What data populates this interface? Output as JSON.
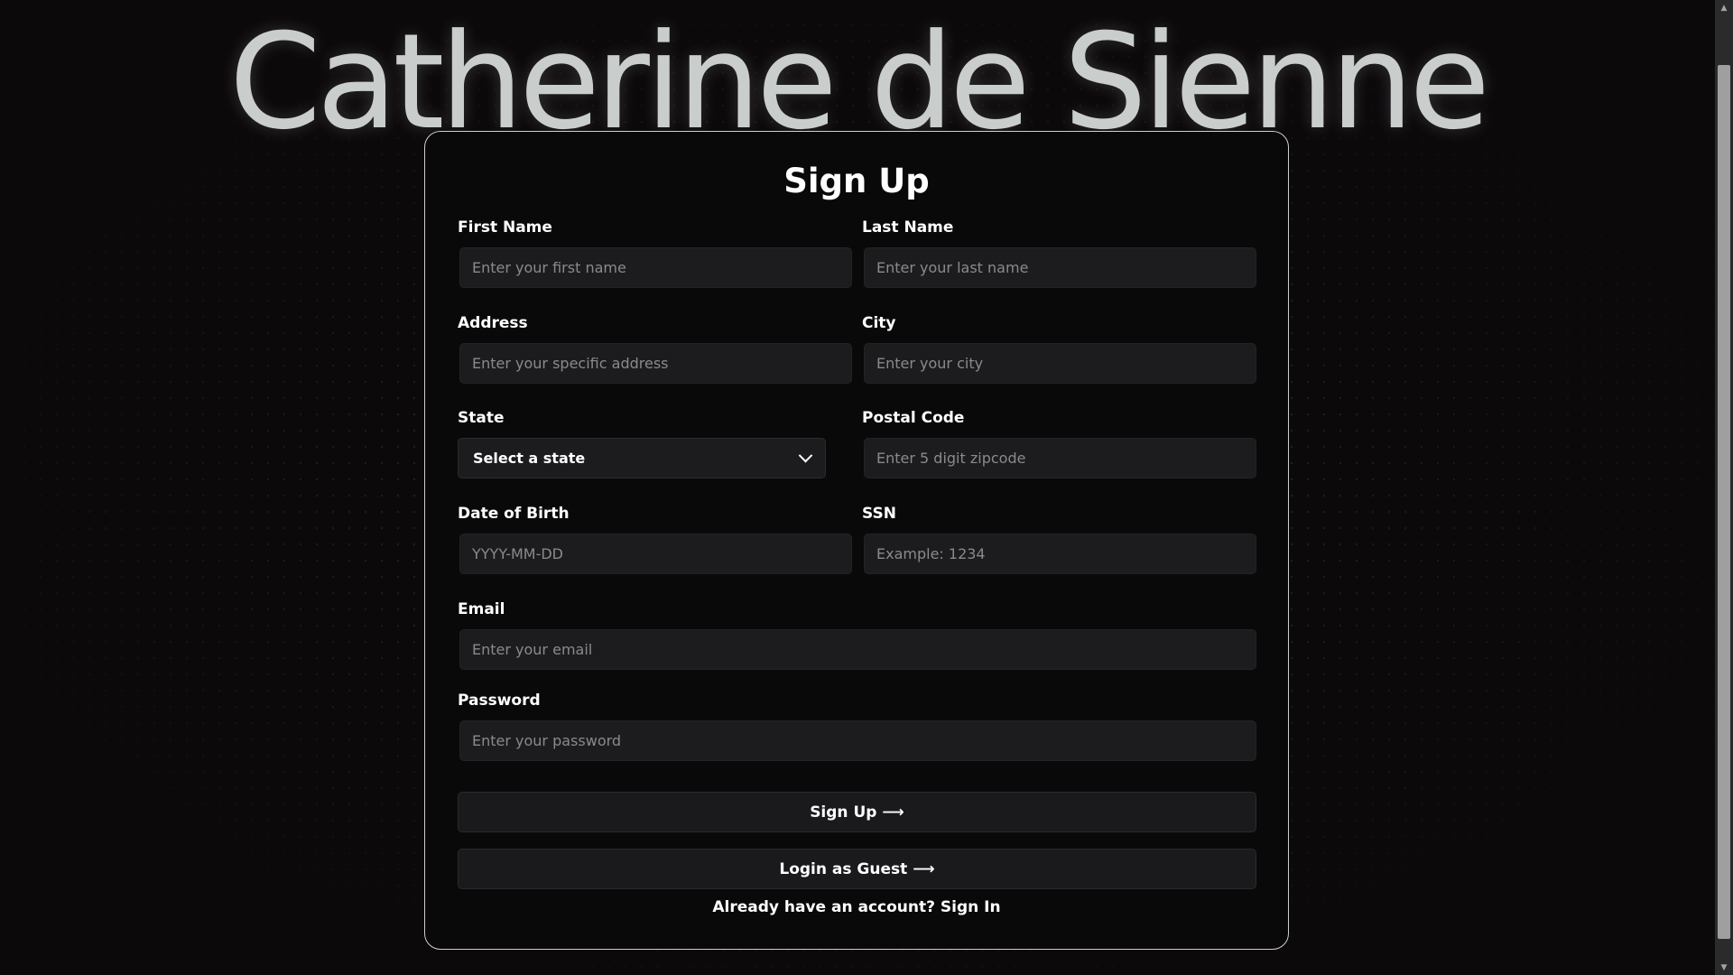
{
  "brand": {
    "name": "Catherine de Sienne"
  },
  "form": {
    "title": "Sign Up",
    "fields": {
      "first_name": {
        "label": "First Name",
        "placeholder": "Enter your first name"
      },
      "last_name": {
        "label": "Last Name",
        "placeholder": "Enter your last name"
      },
      "address": {
        "label": "Address",
        "placeholder": "Enter your specific address"
      },
      "city": {
        "label": "City",
        "placeholder": "Enter your city"
      },
      "state": {
        "label": "State",
        "selected": "Select a state"
      },
      "postal_code": {
        "label": "Postal Code",
        "placeholder": "Enter 5 digit zipcode"
      },
      "dob": {
        "label": "Date of Birth",
        "placeholder": "YYYY-MM-DD"
      },
      "ssn": {
        "label": "SSN",
        "placeholder": "Example: 1234"
      },
      "email": {
        "label": "Email",
        "placeholder": "Enter your email"
      },
      "password": {
        "label": "Password",
        "placeholder": "Enter your password"
      }
    },
    "buttons": {
      "sign_up": "Sign Up",
      "guest": "Login as Guest",
      "arrow": "⟶"
    },
    "signin_prompt": "Already have an account?",
    "signin_link": "Sign In"
  },
  "icons": {
    "state_dropdown": "chevron-down-icon",
    "button_arrow": "arrow-right-icon",
    "scroll_up": "scroll-up-arrow-icon",
    "scroll_down": "scroll-down-arrow-icon"
  },
  "colors": {
    "background": "#0b090a",
    "card_border": "#cfcfcf",
    "input_background": "#1c1c1e",
    "brand_text": "#c9cdcb",
    "placeholder": "#8a8a8e"
  }
}
